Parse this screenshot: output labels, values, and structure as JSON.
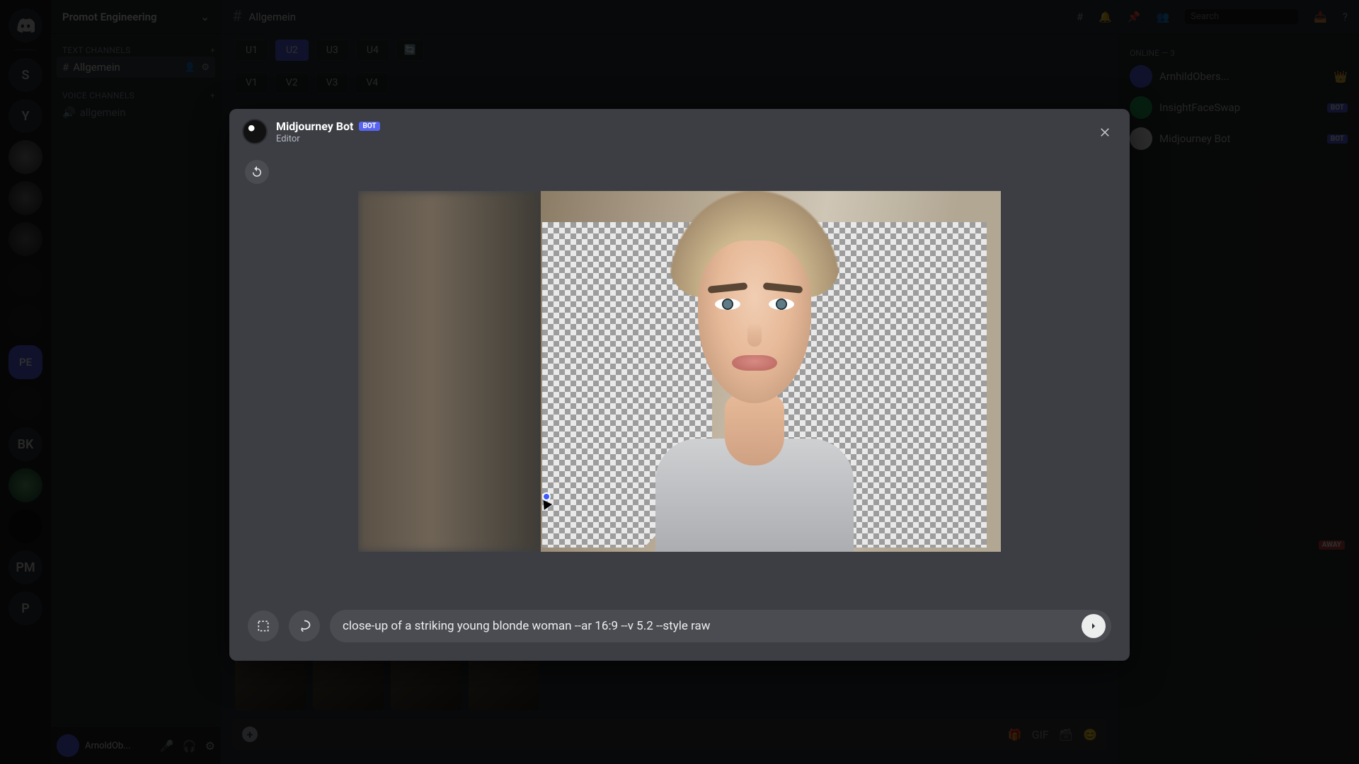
{
  "server": {
    "name": "Promot Engineering",
    "rail_labels": [
      "S",
      "Y",
      "",
      "",
      "",
      "",
      "",
      "",
      "PE",
      "",
      "BK",
      "",
      "",
      "PM",
      "P",
      "",
      ""
    ],
    "sections": {
      "text_channels": "TEXT CHANNELS",
      "voice_channels": "VOICE CHANNELS"
    },
    "channels": [
      {
        "name": "Allgemein",
        "active": true
      },
      {
        "name": "allgemein",
        "active": false
      }
    ]
  },
  "topbar": {
    "channel": "Allgemein",
    "search_placeholder": "Search"
  },
  "message_buttons": {
    "row1": [
      "U1",
      "U2",
      "U3",
      "U4"
    ],
    "row2": [
      "V1",
      "V2",
      "V3",
      "V4"
    ],
    "active": "U2"
  },
  "user_panel": {
    "name": "ArnoldOb..."
  },
  "members_header": "ONLINE — 3",
  "members": [
    {
      "name": "ArnhildObers...",
      "badge": ""
    },
    {
      "name": "InsightFaceSwap",
      "badge": "BOT"
    },
    {
      "name": "Midjourney Bot",
      "badge": "BOT"
    }
  ],
  "away_tag": "AWAY",
  "modal": {
    "bot_name": "Midjourney Bot",
    "bot_badge": "BOT",
    "subtitle": "Editor",
    "prompt": "close-up of a striking young blonde woman --ar 16:9 --v 5.2 --style raw"
  }
}
